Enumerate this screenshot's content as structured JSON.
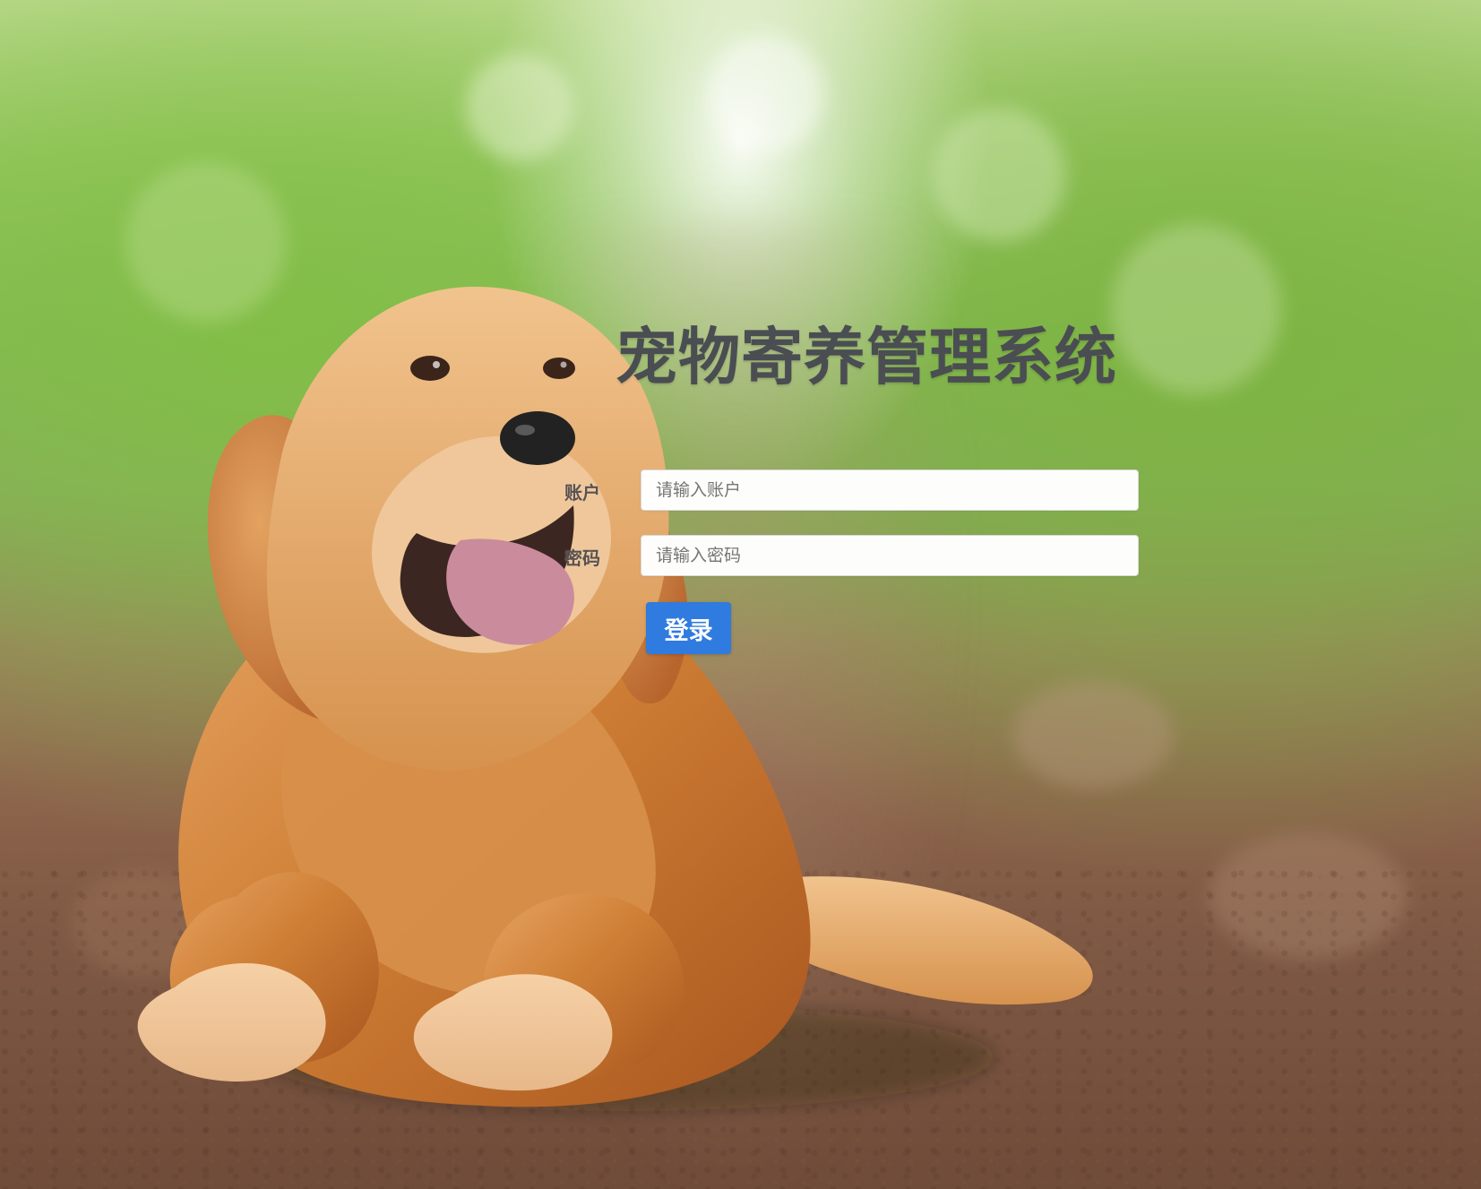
{
  "page": {
    "title": "宠物寄养管理系统"
  },
  "login_form": {
    "account_label": "账户",
    "account_placeholder": "请输入账户",
    "account_value": "",
    "password_label": "密码",
    "password_placeholder": "请输入密码",
    "password_value": "",
    "submit_label": "登录"
  },
  "colors": {
    "title": "#4a4d52",
    "button": "#2f7be0",
    "button_text": "#ffffff",
    "input_bg": "#ffffff"
  },
  "background": {
    "subject": "golden-retriever-photo"
  }
}
